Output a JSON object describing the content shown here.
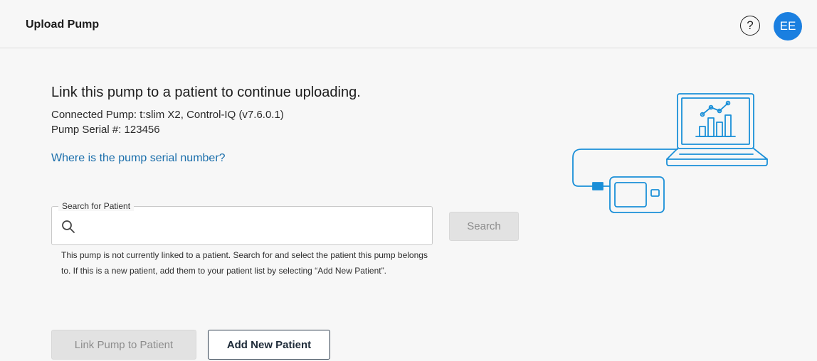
{
  "header": {
    "title": "Upload Pump",
    "help_icon": "question-circle-icon",
    "help_glyph": "?",
    "avatar_initials": "EE",
    "avatar_color": "#1a7fe0"
  },
  "main": {
    "heading": "Link this pump to a patient to continue uploading.",
    "connected_pump": "Connected Pump: t:slim X2, Control-IQ (v7.6.0.1)",
    "serial": "Pump Serial #: 123456",
    "serial_link": "Where is the pump serial number?",
    "search": {
      "label": "Search for Patient",
      "placeholder": "",
      "value": "",
      "icon": "search-icon",
      "button_label": "Search"
    },
    "help_text": "This pump is not currently linked to a patient. Search for and select the patient this pump belongs to. If this is a new patient, add them to your patient list by selecting “Add New Patient”.",
    "link_button_label": "Link Pump to Patient",
    "add_button_label": "Add New Patient"
  },
  "illustration": {
    "icon": "laptop-pump-connection-illustration",
    "stroke_color": "#1a8fd8"
  },
  "colors": {
    "link": "#1a6eab",
    "background": "#f7f7f7",
    "disabled_button": "#e2e2e2"
  }
}
